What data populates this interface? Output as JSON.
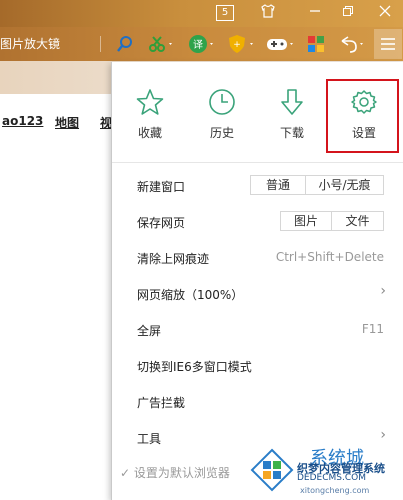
{
  "browser": {
    "tab_badge": "5",
    "address_text": "图片放大镜",
    "page_links": [
      "ao123",
      "地图",
      "视"
    ],
    "colors": {
      "accent": "#3aa37a",
      "highlight": "#d4141c",
      "chrome": "#c98b3e"
    }
  },
  "menu": {
    "top_buttons": [
      {
        "label": "收藏",
        "icon": "star-icon"
      },
      {
        "label": "历史",
        "icon": "clock-icon"
      },
      {
        "label": "下载",
        "icon": "download-arrow-icon"
      },
      {
        "label": "设置",
        "icon": "gear-icon"
      }
    ],
    "items": {
      "new_window": {
        "label": "新建窗口",
        "options": [
          "普通",
          "小号/无痕"
        ]
      },
      "save_page": {
        "label": "保存网页",
        "options": [
          "图片",
          "文件"
        ]
      },
      "clear_history": {
        "label": "清除上网痕迹",
        "shortcut": "Ctrl+Shift+Delete"
      },
      "zoom": {
        "label": "网页缩放（100%）"
      },
      "fullscreen": {
        "label": "全屏",
        "shortcut": "F11"
      },
      "ie6_mode": {
        "label": "切换到IE6多窗口模式"
      },
      "ad_block": {
        "label": "广告拦截"
      },
      "tools": {
        "label": "工具"
      }
    },
    "set_default": "✓ 设置为默认浏览器"
  },
  "watermark": {
    "brand": "系统城",
    "line1": "织梦内容管理系统",
    "line2": "DEDECMS.COM",
    "line3": "xitongcheng.com"
  }
}
